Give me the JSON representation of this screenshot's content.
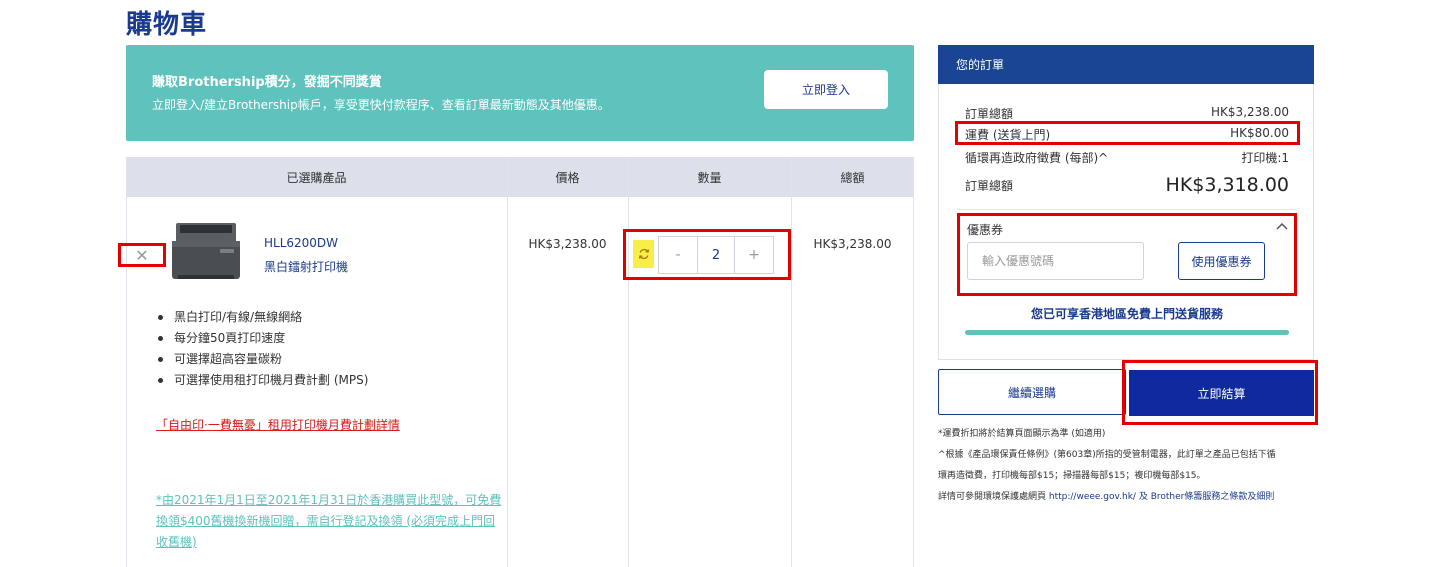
{
  "page": {
    "title": "購物車"
  },
  "promo": {
    "heading": "賺取Brothership積分，發掘不同獎賞",
    "text": "立即登入/建立Brothership帳戶，享受更快付款程序、查看訂單最新動態及其他優惠。",
    "login_label": "立即登入"
  },
  "table": {
    "headers": [
      "已選購產品",
      "價格",
      "數量",
      "總額"
    ],
    "item": {
      "remove_icon": "close-icon",
      "model": "HLL6200DW",
      "description": "黑白鐳射打印機",
      "features": [
        "黑白打印/有線/無線網絡",
        "每分鐘50頁打印速度",
        "可選擇超高容量碳粉",
        "可選擇使用租打印機月費計劃 (MPS)"
      ],
      "mps_link": "「自由印·一費無憂」租用打印機月費計劃詳情",
      "trade_in_note": "*由2021年1月1日至2021年1月31日於香港購買此型號，可免費換領$400舊機換新機回贈，需自行登記及換領 (必須完成上門回收舊機)",
      "price": "HK$3,238.00",
      "quantity": "2",
      "minus_label": "-",
      "plus_label": "+",
      "refresh_icon": "refresh-icon",
      "total": "HK$3,238.00"
    }
  },
  "summary": {
    "header": "您的訂單",
    "rows": [
      {
        "label": "訂單總額",
        "value": "HK$3,238.00"
      },
      {
        "label": "運費 (送貨上門)",
        "value": "HK$80.00"
      },
      {
        "label": "循環再造政府徵費 (每部)^",
        "value": "打印機:1"
      }
    ],
    "grand_total_label": "訂單總額",
    "grand_total_value": "HK$3,318.00",
    "coupon": {
      "label": "優惠券",
      "placeholder": "輸入優惠號碼",
      "apply_label": "使用優惠券",
      "chevron_icon": "chevron-up-icon"
    },
    "free_shipping": "您已可享香港地區免費上門送貨服務",
    "free_shipping_progress": 1.0
  },
  "actions": {
    "continue_label": "繼續選購",
    "checkout_label": "立即結算"
  },
  "notes": [
    "*運費折扣將於結算頁面顯示為準 (如適用)",
    "^根據《產品環保責任條例》(第603章)所指的受管制電器，此訂單之產品已包括下循",
    "環再造徵費，打印機每部$15；掃描器每部$15；複印機每部$15。"
  ],
  "notes_last": {
    "prefix": "詳情可參閱環境保護處網頁",
    "url": "http://weee.gov.hk/",
    "suffix": "及 Brother條籌服務之條款及細則"
  },
  "colors": {
    "brand": "#1a3a8f",
    "teal": "#5ec2bd",
    "highlight": "#e30000"
  }
}
